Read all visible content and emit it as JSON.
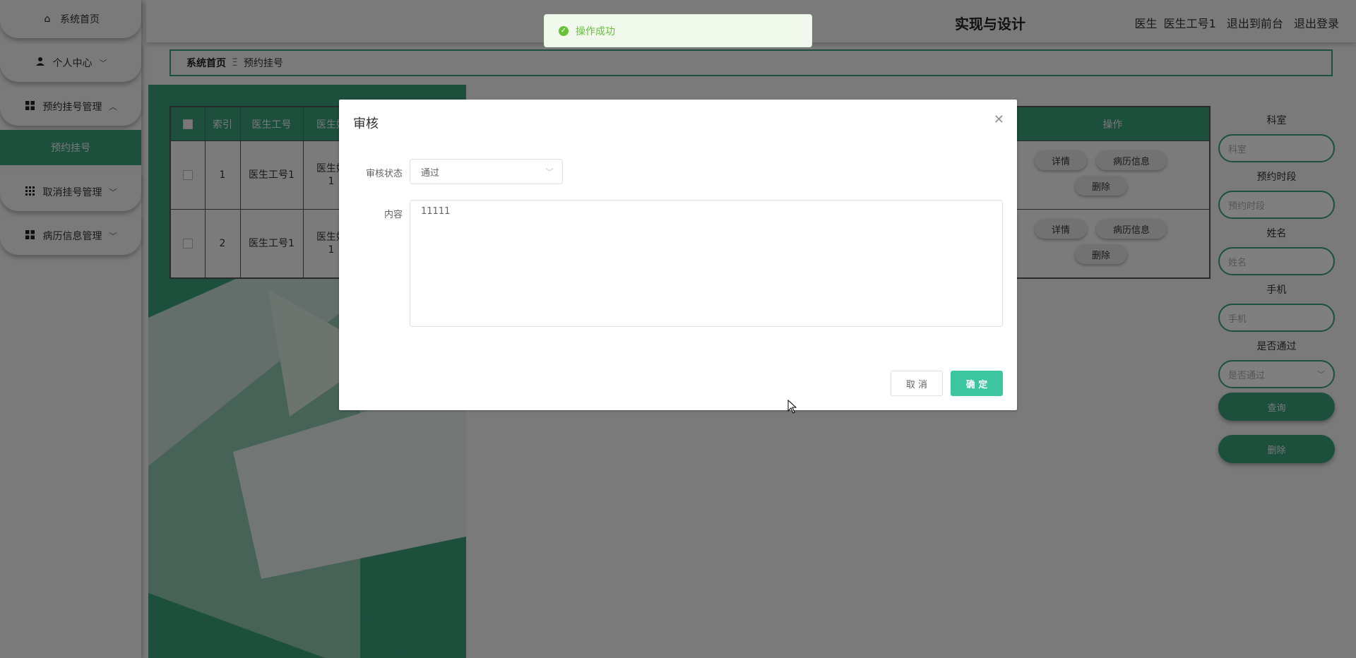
{
  "sidebar": {
    "items": [
      {
        "label": "系统首页",
        "icon": "home-icon"
      },
      {
        "label": "个人中心",
        "icon": "user-icon"
      },
      {
        "label": "预约挂号管理",
        "icon": "grid-icon"
      },
      {
        "label": "取消挂号管理",
        "icon": "apps-icon"
      },
      {
        "label": "病历信息管理",
        "icon": "grid-icon"
      }
    ],
    "active_sub": "预约挂号"
  },
  "header": {
    "title_visible": "实现与设计",
    "user_role": "医生",
    "user_name": "医生工号1",
    "back_front": "退出到前台",
    "logout": "退出登录"
  },
  "breadcrumb": {
    "home": "系统首页",
    "separator": "Ξ",
    "current": "预约挂号"
  },
  "table": {
    "columns": [
      "索引",
      "医生工号",
      "医生姓",
      "操作"
    ],
    "rows": [
      {
        "index": "1",
        "doctor_id": "医生工号1",
        "doctor_name_a": "医生姓",
        "doctor_name_b": "1"
      },
      {
        "index": "2",
        "doctor_id": "医生工号1",
        "doctor_name_a": "医生姓",
        "doctor_name_b": "1"
      }
    ],
    "actions": {
      "detail": "详情",
      "record": "病历信息",
      "delete": "删除"
    }
  },
  "search_panel": {
    "dept_label": "科室",
    "dept_placeholder": "科室",
    "period_label": "预约时段",
    "period_placeholder": "预约时段",
    "name_label": "姓名",
    "name_placeholder": "姓名",
    "phone_label": "手机",
    "phone_placeholder": "手机",
    "pass_label": "是否通过",
    "pass_placeholder": "是否通过",
    "search_button": "查询",
    "delete_button": "删除"
  },
  "toast": {
    "message": "操作成功"
  },
  "dialog": {
    "title": "审核",
    "status_label": "审核状态",
    "status_value": "通过",
    "content_label": "内容",
    "content_value": "11111",
    "cancel": "取 消",
    "confirm": "确 定"
  },
  "colors": {
    "accent": "#3a9e7b",
    "confirm": "#3bc6a0",
    "success": "#67c23a"
  }
}
